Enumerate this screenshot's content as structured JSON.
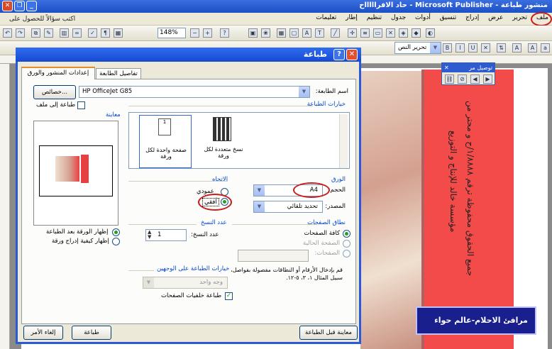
{
  "window": {
    "title": "منشور طباعة - Microsoft Publisher - حاد الافراااااح"
  },
  "menu": {
    "items": [
      "ملف",
      "تحرير",
      "عرض",
      "إدراج",
      "تنسيق",
      "أدوات",
      "جدول",
      "تنظيم",
      "إطار",
      "تعليمات"
    ],
    "help_text": "اكتب سؤالاً للحصول على"
  },
  "toolbar": {
    "zoom": "148%",
    "font_box": "تحرير النص"
  },
  "connect_toolbar": {
    "title": "توصيل مر"
  },
  "page": {
    "vertical_text_1": "جميع الحقوق محفوظة ترقم ١/٨٨٨٨/ح و محتر من",
    "vertical_text_2": "مؤسسة خالد للإنتاج و التوزيع",
    "stamp": "مرافئ الاحلام-عالم حواء"
  },
  "dialog": {
    "title": "طباعة",
    "tabs": [
      "إعدادات المنشور والورق",
      "تفاصيل الطابعة"
    ],
    "printer_name_label": "اسم الطابعة:",
    "printer_name": "HP OfficeJet G85",
    "properties_button": "خصائص...",
    "print_to_file": "طباعة إلى ملف",
    "print_options_group": "خيارات الطباعة",
    "option_multiple": "نسخ متعددة لكل ورقة",
    "option_single": "صفحة واحدة لكل ورقة",
    "preview_group": "معاينة",
    "preview_page": "1",
    "paper_group": "الورق",
    "size_label": "الحجم:",
    "size_value": "A4",
    "source_label": "المصدر:",
    "source_value": "تحديد تلقائي",
    "orientation_group": "الاتجاه",
    "portrait": "عمودي",
    "landscape": "أفقي",
    "page_range_group": "نطاق الصفحات",
    "all_pages": "كافة الصفحات",
    "current_page": "الصفحة الحالية",
    "pages": "الصفحات:",
    "range_hint": "قم بإدخال الأرقام أو النطاقات مفصولة بفواصل، على سبيل المثال ١، ٣، ٥-١٢.",
    "copies_group": "عدد النسخ",
    "copies_label": "عدد النسخ:",
    "copies_value": "1",
    "duplex_group": "خيارات الطباعة على الوجهين",
    "duplex_value": "وجه واحد",
    "print_backgrounds": "طباعة خلفيات الصفحات",
    "show_paper": "إظهار الورقة بعد الطباعة",
    "show_insert": "إظهار كيفية إدراج ورقة",
    "preview_button": "معاينة قبل الطباعة",
    "print_button": "طباعة",
    "cancel_button": "إلغاء الأمر"
  }
}
